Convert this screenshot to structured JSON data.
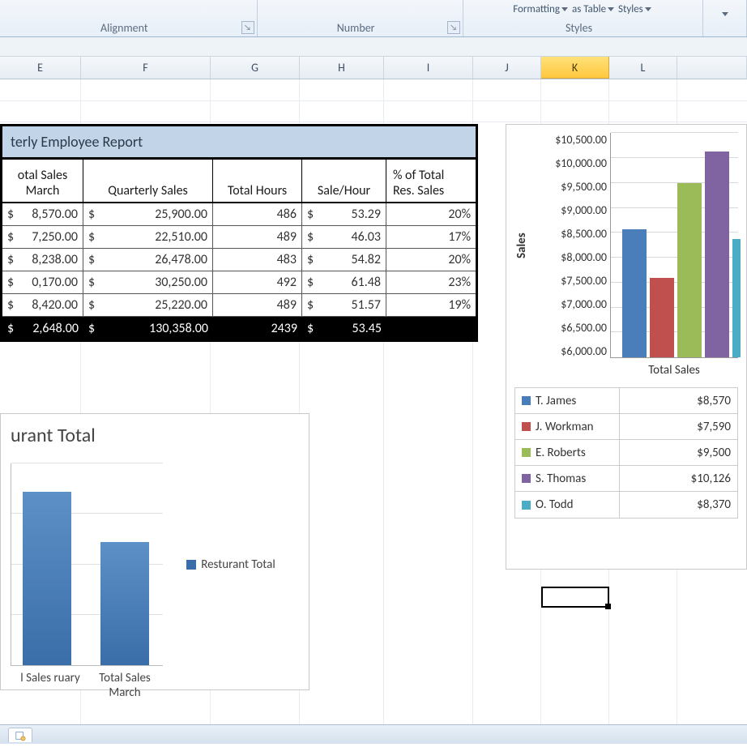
{
  "ribbon": {
    "alignment_label": "Alignment",
    "number_label": "Number",
    "styles_label": "Styles",
    "styles_items": {
      "formatting": "Formatting",
      "astable": "as Table",
      "styles": "Styles"
    }
  },
  "columns": [
    "E",
    "F",
    "G",
    "H",
    "I",
    "J",
    "K",
    "L"
  ],
  "active_col": "K",
  "table": {
    "title": "terly Employee Report",
    "headers": [
      "otal Sales March",
      "Quarterly Sales",
      "Total Hours",
      "Sale/Hour",
      "% of Total Res. Sales"
    ],
    "rows": [
      {
        "march": "8,570.00",
        "qsales": "25,900.00",
        "hours": "486",
        "sph": "53.29",
        "pct": "20%"
      },
      {
        "march": "7,250.00",
        "qsales": "22,510.00",
        "hours": "489",
        "sph": "46.03",
        "pct": "17%"
      },
      {
        "march": "8,238.00",
        "qsales": "26,478.00",
        "hours": "483",
        "sph": "54.82",
        "pct": "20%"
      },
      {
        "march": "0,170.00",
        "qsales": "30,250.00",
        "hours": "492",
        "sph": "61.48",
        "pct": "23%"
      },
      {
        "march": "8,420.00",
        "qsales": "25,220.00",
        "hours": "489",
        "sph": "51.57",
        "pct": "19%"
      }
    ],
    "totals": {
      "march": "2,648.00",
      "qsales": "130,358.00",
      "hours": "2439",
      "sph": "53.45"
    }
  },
  "chart1_labels": {
    "title": "urant Total",
    "cat1": "l Sales ruary",
    "cat2": "Total Sales March",
    "legend": "Resturant Total"
  },
  "chart2_labels": {
    "ylabel": "Sales",
    "cat": "Total Sales",
    "ticks": [
      "$10,500.00",
      "$10,000.00",
      "$9,500.00",
      "$9,000.00",
      "$8,500.00",
      "$8,000.00",
      "$7,500.00",
      "$7,000.00",
      "$6,500.00",
      "$6,000.00"
    ],
    "legend": [
      {
        "name": "T. James",
        "val": "$8,570",
        "color": "#4a7ebb"
      },
      {
        "name": "J. Workman",
        "val": "$7,590",
        "color": "#c0504d"
      },
      {
        "name": "E. Roberts",
        "val": "$9,500",
        "color": "#9bbb59"
      },
      {
        "name": "S. Thomas",
        "val": "$10,126",
        "color": "#8064a2"
      },
      {
        "name": "O. Todd",
        "val": "$8,370",
        "color": "#4bacc6"
      }
    ]
  },
  "currency": "$",
  "chart_data": [
    {
      "type": "bar",
      "title": "Resturant Total",
      "categories": [
        "Total Sales February",
        "Total Sales March"
      ],
      "values": [
        60000,
        42648
      ],
      "ylim": [
        0,
        70000
      ]
    },
    {
      "type": "bar",
      "title": "Total Sales",
      "xlabel": "",
      "ylabel": "Sales",
      "categories": [
        "T. James",
        "J. Workman",
        "E. Roberts",
        "S. Thomas",
        "O. Todd"
      ],
      "values": [
        8570,
        7590,
        9500,
        10126,
        8370
      ],
      "ylim": [
        6000,
        10500
      ]
    }
  ]
}
